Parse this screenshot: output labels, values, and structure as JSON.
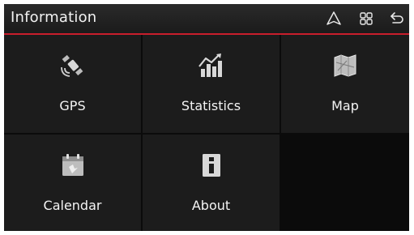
{
  "header": {
    "title": "Information"
  },
  "header_icons": [
    "navigation-icon",
    "grid-menu-icon",
    "back-icon"
  ],
  "tiles": [
    {
      "label": "GPS",
      "icon": "satellite-icon"
    },
    {
      "label": "Statistics",
      "icon": "statistics-chart-icon"
    },
    {
      "label": "Map",
      "icon": "map-icon"
    },
    {
      "label": "Calendar",
      "icon": "calendar-icon"
    },
    {
      "label": "About",
      "icon": "info-icon"
    }
  ],
  "colors": {
    "accent": "#c81e2c",
    "tile": "#1c1c1c",
    "background": "#0b0b0b"
  }
}
